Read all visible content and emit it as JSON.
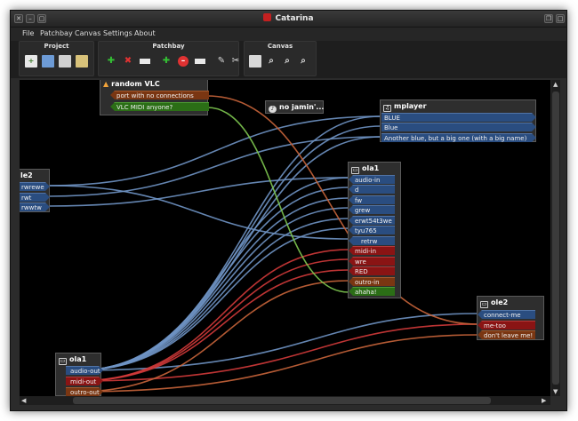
{
  "window": {
    "title": "Catarina"
  },
  "menu": [
    "File",
    "Patchbay",
    "Canvas",
    "Settings",
    "About"
  ],
  "toolbar": {
    "project_label": "Project",
    "patchbay_label": "Patchbay",
    "canvas_label": "Canvas"
  },
  "boxes": {
    "random_vlc": {
      "title": "random VLC",
      "ports": [
        "port with no connections",
        "VLC MIDI anyone?"
      ]
    },
    "no_jamin": {
      "title": "no jamin'..."
    },
    "mplayer": {
      "title": "mplayer",
      "ports": [
        "BLUE",
        "Blue",
        "Another blue, but a big one (with a big name)"
      ]
    },
    "ole2_left": {
      "title": "le2",
      "ports": [
        "rwrewe",
        "rwt",
        "rwwtw"
      ]
    },
    "ola1_mid": {
      "title": "ola1",
      "ports": [
        "audio-in",
        "d",
        "fw",
        "grew",
        "erwt54t3we",
        "tyu765",
        "retrw",
        "midi-in",
        "wre",
        "RED",
        "outro-in",
        "ahaha!"
      ]
    },
    "ole2_right": {
      "title": "ole2",
      "ports": [
        "connect-me",
        "me-too",
        "don't leave me!"
      ]
    },
    "ola1_bottom": {
      "title": "ola1",
      "ports": [
        "audio-out",
        "midi-out",
        "outro-out"
      ]
    }
  },
  "colors": {
    "audio": "#2a4d80",
    "midi": "#8a1414",
    "outro": "#7a3612",
    "green": "#2b6e16",
    "link_audio": "#6f93c4",
    "link_midi": "#d23a3a",
    "link_outro": "#c8643a",
    "link_green": "#7ec850"
  }
}
